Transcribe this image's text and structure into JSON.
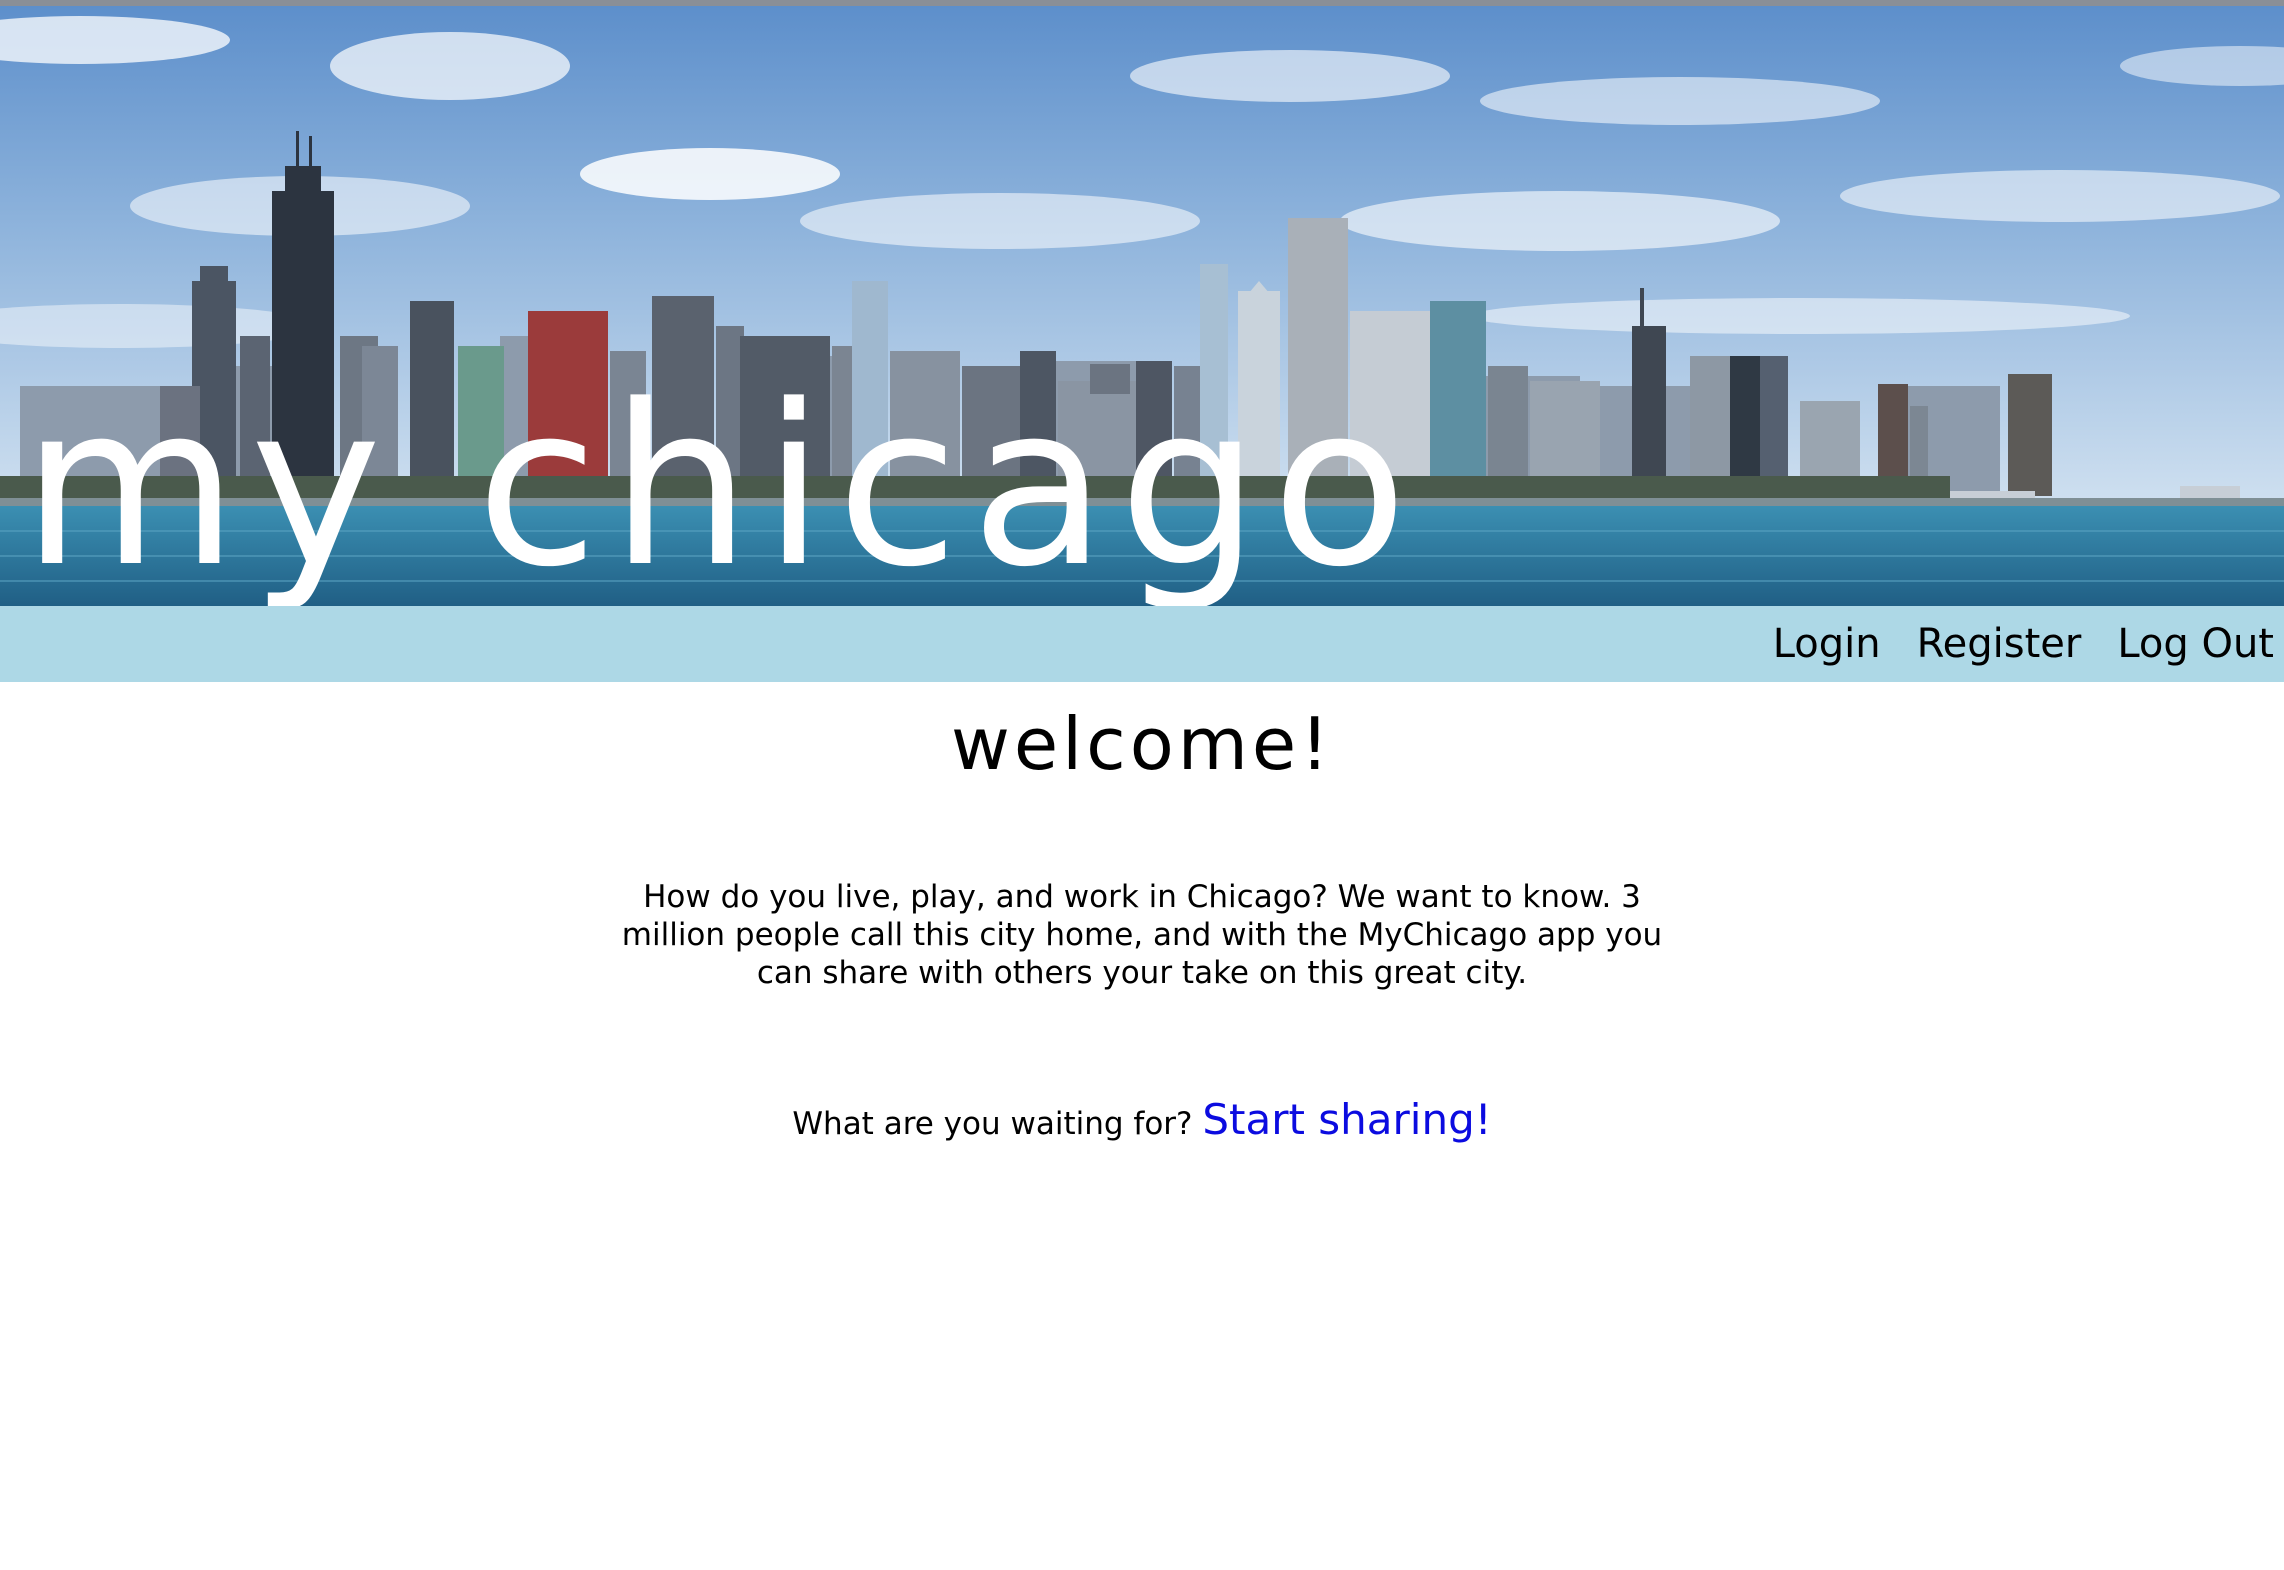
{
  "header": {
    "site_title": "My Chicago",
    "banner_image": "chicago-skyline-lakefront"
  },
  "nav": {
    "items": [
      {
        "label": "Login"
      },
      {
        "label": "Register"
      },
      {
        "label": "Log Out"
      }
    ]
  },
  "main": {
    "heading": "welcome!",
    "intro": "How do you live, play, and work in Chicago? We want to know. 3 million people call this city home, and with the MyChicago app you can share with others your take on this great city.",
    "cta_prompt": "What are you waiting for?",
    "cta_link": "Start sharing!"
  },
  "colors": {
    "nav_background": "#add8e6",
    "link_blue": "#0b0be0",
    "hero_title": "#ffffff",
    "sky": "#8fb4dc",
    "lake": "#2f7ea0"
  }
}
